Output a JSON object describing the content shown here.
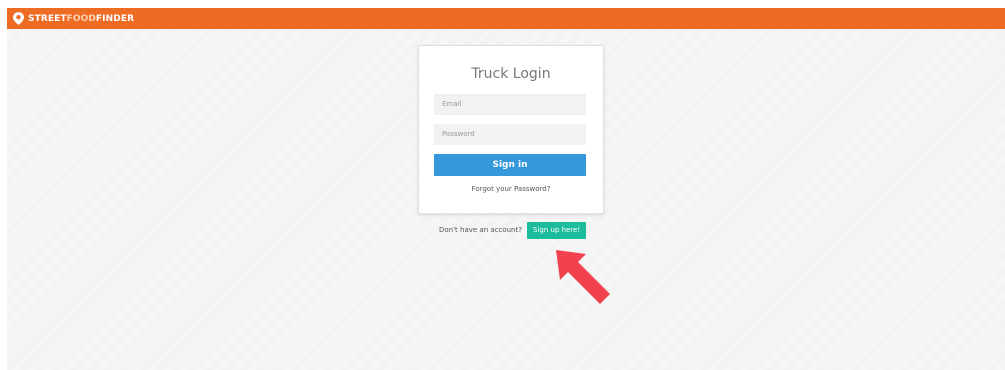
{
  "brand": {
    "word1": "STREET",
    "word2": "FOOD",
    "word3": "FINDER",
    "icon": "map-pin-icon"
  },
  "login": {
    "title": "Truck Login",
    "email_placeholder": "Email",
    "password_placeholder": "Password",
    "signin_label": "Sign in",
    "forgot_label": "Forgot your Password?"
  },
  "signup": {
    "prompt": "Don't have an account?",
    "button_label": "Sign up here!"
  },
  "annotation": {
    "icon": "red-arrow-icon"
  },
  "colors": {
    "topbar": "#ee6b24",
    "signin_button": "#3498db",
    "signup_button": "#1abc9c",
    "arrow": "#f2424f"
  }
}
